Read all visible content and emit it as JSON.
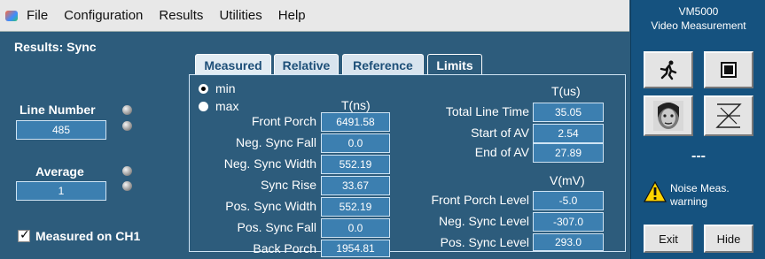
{
  "menu": {
    "items": [
      "File",
      "Configuration",
      "Results",
      "Utilities",
      "Help"
    ]
  },
  "left": {
    "title": "Results: Sync",
    "line_number_label": "Line Number",
    "line_number_value": "485",
    "average_label": "Average",
    "average_value": "1",
    "measured_on_label": "Measured on CH1",
    "measured_on_checked": true
  },
  "tabs": [
    "Measured",
    "Relative",
    "Reference",
    "Limits"
  ],
  "radio": {
    "min_label": "min",
    "max_label": "max",
    "selected": "min"
  },
  "table_left": {
    "header": "T(ns)",
    "rows": [
      {
        "label": "Front Porch",
        "value": "6491.58"
      },
      {
        "label": "Neg. Sync Fall",
        "value": "0.0"
      },
      {
        "label": "Neg. Sync Width",
        "value": "552.19"
      },
      {
        "label": "Sync Rise",
        "value": "33.67"
      },
      {
        "label": "Pos. Sync Width",
        "value": "552.19"
      },
      {
        "label": "Pos. Sync Fall",
        "value": "0.0"
      },
      {
        "label": "Back Porch",
        "value": "1954.81"
      }
    ]
  },
  "table_time": {
    "header": "T(us)",
    "rows": [
      {
        "label": "Total Line Time",
        "value": "35.05"
      },
      {
        "label": "Start of AV",
        "value": "2.54"
      },
      {
        "label": "End of AV",
        "value": "27.89"
      }
    ]
  },
  "table_volt": {
    "header": "V(mV)",
    "rows": [
      {
        "label": "Front Porch Level",
        "value": "-5.0"
      },
      {
        "label": "Neg. Sync Level",
        "value": "-307.0"
      },
      {
        "label": "Pos. Sync Level",
        "value": "293.0"
      }
    ]
  },
  "side": {
    "title1": "VM5000",
    "title2": "Video Measurement",
    "status": "---",
    "warning_line1": "Noise Meas.",
    "warning_line2": "warning",
    "exit_label": "Exit",
    "hide_label": "Hide"
  },
  "colors": {
    "panel_bg": "#2d5c7c",
    "value_box": "#3c7fb0",
    "side_bg": "#15527f",
    "menubar_bg": "#e8e8e8"
  }
}
